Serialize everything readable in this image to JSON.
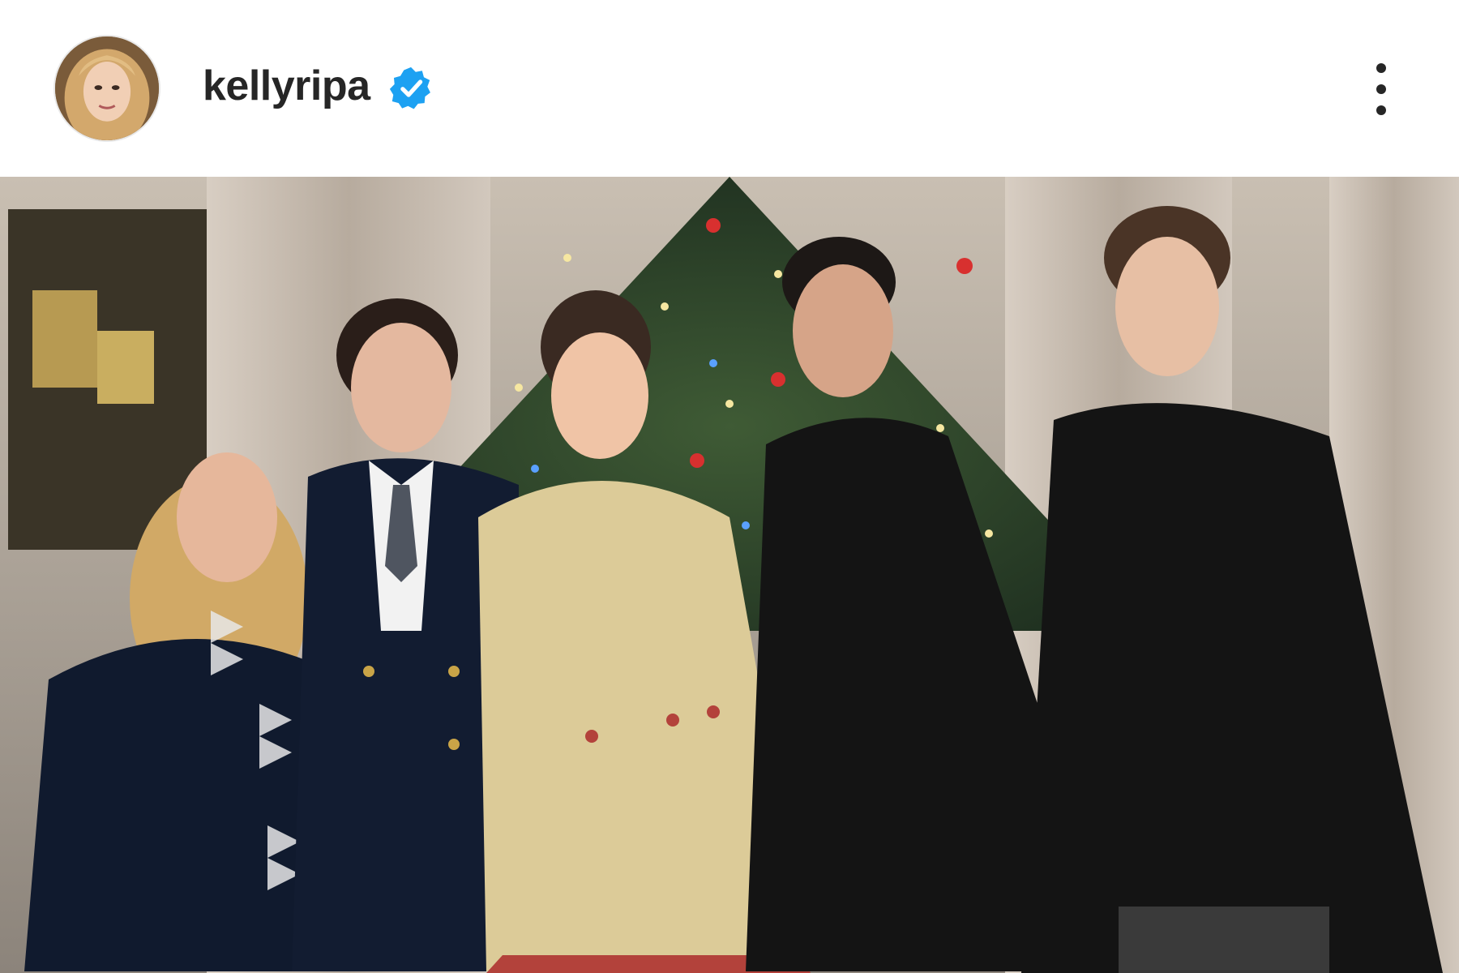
{
  "post": {
    "username": "kellyripa",
    "verified": true,
    "avatar_icon": "profile-photo",
    "more_icon": "vertical-ellipsis-icon",
    "accent_color": "#0095f6"
  },
  "photo": {
    "icon": "photo-christmas-family"
  }
}
